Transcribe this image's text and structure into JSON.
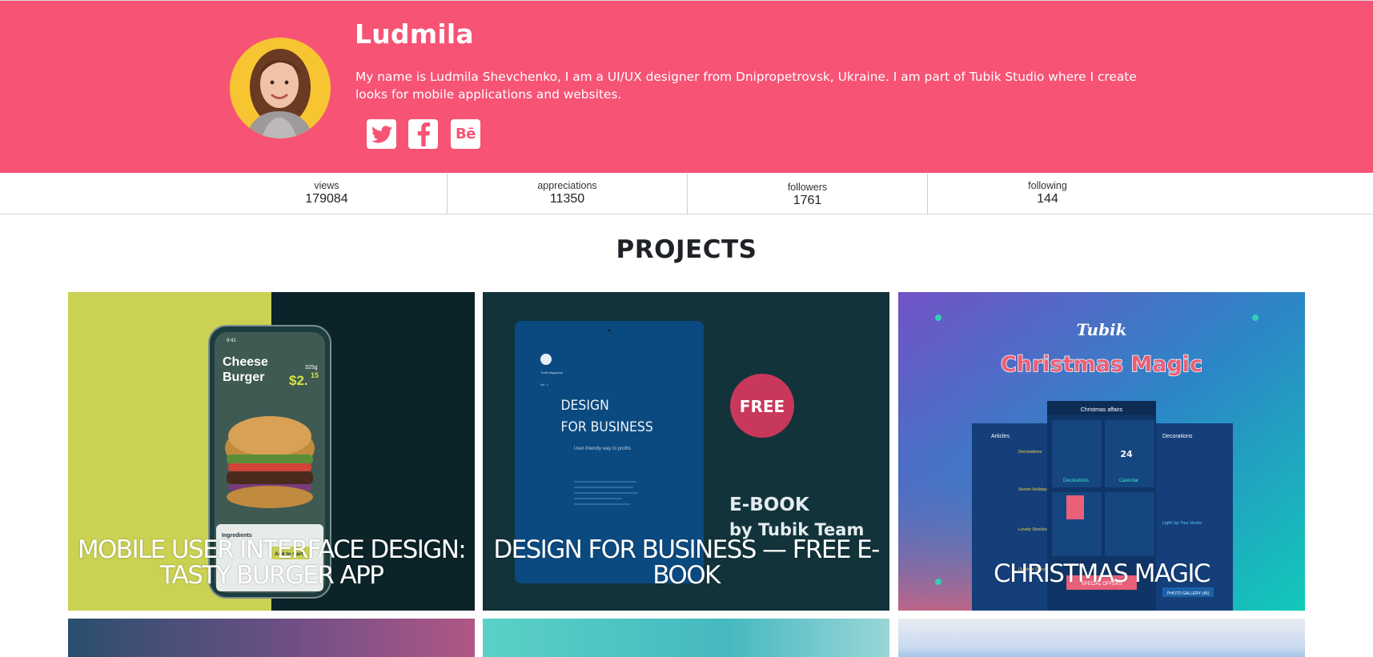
{
  "profile": {
    "name": "Ludmila",
    "bio": "My name is Ludmila Shevchenko, I am a UI/UX designer from Dnipropetrovsk, Ukraine. I am part of Tubik Studio where I create looks for mobile applications and websites.",
    "social": [
      {
        "icon": "twitter-icon"
      },
      {
        "icon": "facebook-icon"
      },
      {
        "icon": "behance-icon",
        "text": "Bē"
      }
    ]
  },
  "colors": {
    "header_bg": "#f65375",
    "text_on_header": "#ffffff",
    "avatar_bg": "#f7c531"
  },
  "stats": [
    {
      "label": "views",
      "value": "179084"
    },
    {
      "label": "appreciations",
      "value": "11350"
    },
    {
      "label": "followers",
      "value": "1761"
    },
    {
      "label": "following",
      "value": "144"
    }
  ],
  "projects": {
    "heading": "PROJECTS",
    "cards": [
      {
        "title": "MOBILE USER INTERFACE DESIGN: TASTY BURGER APP",
        "art": {
          "food_title_1": "Cheese",
          "food_title_2": "Burger",
          "weight": "325g",
          "price": "$2.",
          "price_cents": "15",
          "ingredients": "Ingredients",
          "button": "Add to Cart",
          "status_time": "9:41"
        }
      },
      {
        "title": "DESIGN FOR BUSINESS — FREE E-BOOK",
        "art": {
          "book_line_1": "DESIGN",
          "book_line_2": "FOR BUSINESS",
          "book_sub": "User-friendly way to profits",
          "publisher": "Tubik Magazine",
          "issue": "No. 1",
          "badge": "FREE",
          "ebook_line_1": "E-BOOK",
          "ebook_line_2": "by Tubik Team"
        }
      },
      {
        "title": "CHRISTMAS MAGIC",
        "art": {
          "brand": "Tubik",
          "headline": "Christmas Magic",
          "center_header": "Christmas affairs",
          "left_header": "Articles",
          "right_header": "Decorations",
          "tile_1": "Decorations",
          "tile_2": "Calendar",
          "calendar_day": "24",
          "link_1": "Decorations",
          "link_2": "Secret Holiday G...",
          "link_3": "Lovely Stockings",
          "link_4": "Outdoor Decorati...",
          "light_title": "Light Up Your Home",
          "gallery": "PHOTO GALLERY (45)",
          "offers": "SPECIAL OFFERS"
        }
      }
    ]
  }
}
